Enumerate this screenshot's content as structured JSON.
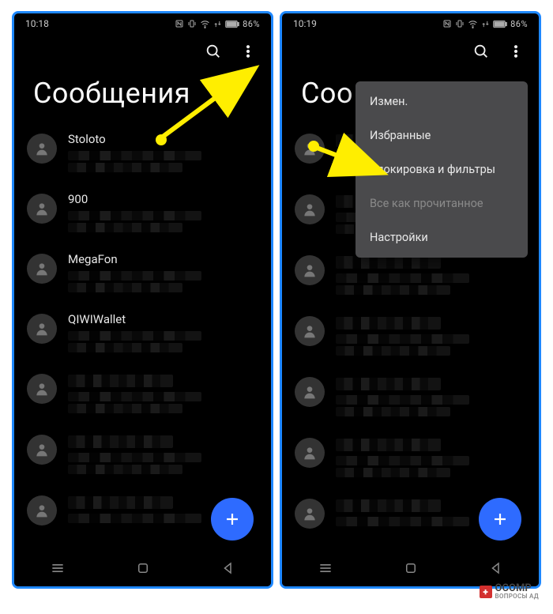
{
  "left": {
    "time": "10:18",
    "battery": "86%",
    "title": "Сообщения",
    "senders": [
      "Stoloto",
      "900",
      "MegaFon",
      "QIWIWallet"
    ]
  },
  "right": {
    "time": "10:19",
    "battery": "86%",
    "title": "Соо",
    "menu": {
      "edit": "Измен.",
      "fav": "Избранные",
      "block": "Блокировка и фильтры",
      "readall": "Все как прочитанное",
      "settings": "Настройки"
    }
  },
  "watermark": {
    "brand": "OCOMP",
    "sub": "ВОПРОСЫ АД"
  }
}
